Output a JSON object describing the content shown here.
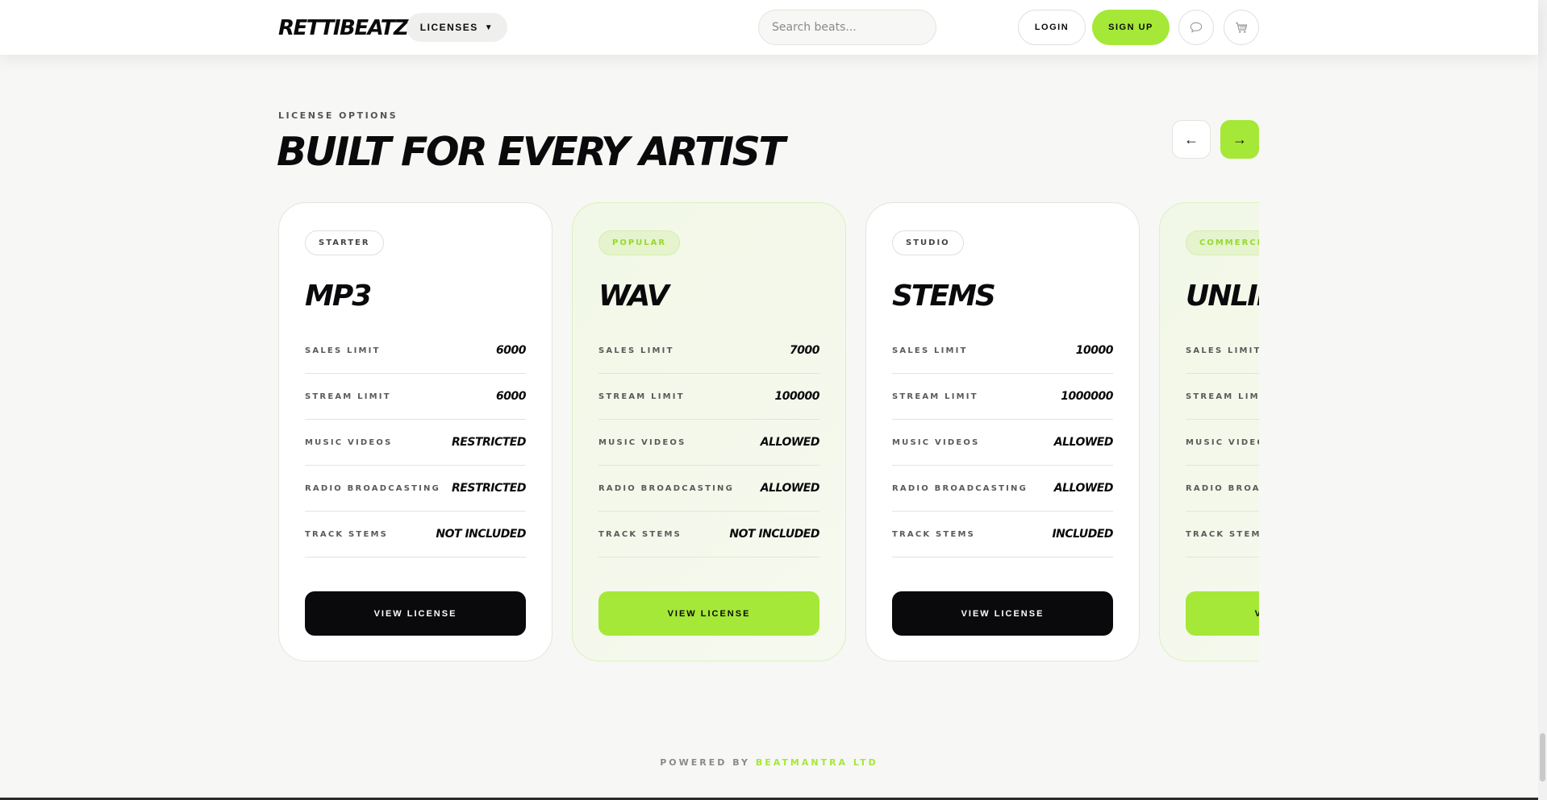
{
  "header": {
    "logo": "RETTIBEATZ",
    "licenses_label": "LICENSES",
    "licenses_caret": "▼",
    "search_placeholder": "Search beats...",
    "login_label": "LOGIN",
    "signup_label": "SIGN UP",
    "chat_icon": "chat-bubble-icon",
    "cart_icon": "cart-icon"
  },
  "section": {
    "eyebrow": "LICENSE OPTIONS",
    "title": "BUILT FOR EVERY ARTIST",
    "prev_label": "←",
    "next_label": "→"
  },
  "cards": [
    {
      "tier": "STARTER",
      "name": "MP3",
      "rows": [
        {
          "label": "SALES LIMIT",
          "value": "6000"
        },
        {
          "label": "STREAM LIMIT",
          "value": "6000"
        },
        {
          "label": "MUSIC VIDEOS",
          "value": "RESTRICTED"
        },
        {
          "label": "RADIO BROADCASTING",
          "value": "RESTRICTED"
        },
        {
          "label": "TRACK STEMS",
          "value": "NOT INCLUDED"
        }
      ],
      "cta": "VIEW LICENSE"
    },
    {
      "tier": "POPULAR",
      "name": "WAV",
      "rows": [
        {
          "label": "SALES LIMIT",
          "value": "7000"
        },
        {
          "label": "STREAM LIMIT",
          "value": "100000"
        },
        {
          "label": "MUSIC VIDEOS",
          "value": "ALLOWED"
        },
        {
          "label": "RADIO BROADCASTING",
          "value": "ALLOWED"
        },
        {
          "label": "TRACK STEMS",
          "value": "NOT INCLUDED"
        }
      ],
      "cta": "VIEW LICENSE"
    },
    {
      "tier": "STUDIO",
      "name": "STEMS",
      "rows": [
        {
          "label": "SALES LIMIT",
          "value": "10000"
        },
        {
          "label": "STREAM LIMIT",
          "value": "1000000"
        },
        {
          "label": "MUSIC VIDEOS",
          "value": "ALLOWED"
        },
        {
          "label": "RADIO BROADCASTING",
          "value": "ALLOWED"
        },
        {
          "label": "TRACK STEMS",
          "value": "INCLUDED"
        }
      ],
      "cta": "VIEW LICENSE"
    },
    {
      "tier": "COMMERCIAL",
      "name": "UNLIMITED",
      "rows": [
        {
          "label": "SALES LIMIT",
          "value": ""
        },
        {
          "label": "STREAM LIMIT",
          "value": ""
        },
        {
          "label": "MUSIC VIDEOS",
          "value": ""
        },
        {
          "label": "RADIO BROADCASTING",
          "value": ""
        },
        {
          "label": "TRACK STEMS",
          "value": ""
        }
      ],
      "cta": "VIEW LICENSE"
    }
  ],
  "footer": {
    "powered_by": "POWERED BY",
    "brand": "BEATMANTRA LTD"
  },
  "colors": {
    "accent": "#a5e838",
    "dark": "#0a0a0c",
    "background": "#f7f7f5"
  }
}
